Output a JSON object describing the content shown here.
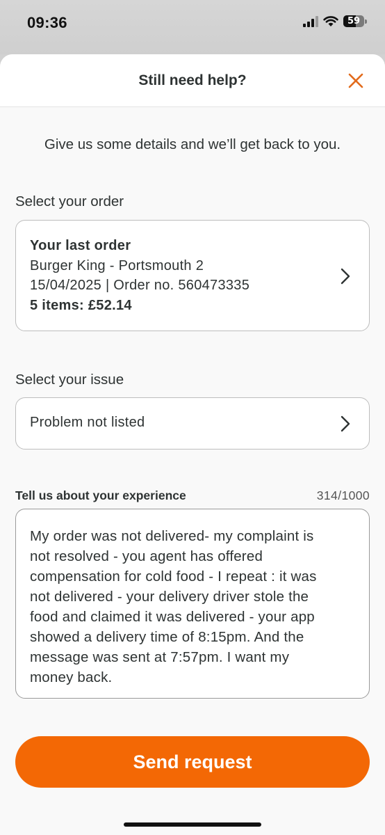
{
  "status_bar": {
    "time": "09:36",
    "battery": "59",
    "battery_level": 0.59
  },
  "header": {
    "title": "Still need help?",
    "close_icon": "close-icon",
    "accent_color": "#e26b1c"
  },
  "intro_text": "Give us some details and we’ll get back to you.",
  "order_section": {
    "label": "Select your order",
    "card": {
      "title": "Your last order",
      "restaurant": "Burger King - Portsmouth 2",
      "date_and_order": "15/04/2025 | Order no. 560473335",
      "summary": "5 items: £52.14",
      "chevron_icon": "chevron-right-icon"
    }
  },
  "issue_section": {
    "label": "Select your issue",
    "value": "Problem not listed",
    "chevron_icon": "chevron-right-icon"
  },
  "experience_section": {
    "label": "Tell us about your experience",
    "counter": "314/1000",
    "text": "My order was not delivered- my complaint is\nnot resolved - you agent has offered\ncompensation for cold food  - I repeat :  it was\nnot delivered - your delivery driver stole the\nfood and claimed it was delivered - your app\nshowed a delivery time of 8:15pm. And the\nmessage was sent at 7:57pm. I want my\nmoney back."
  },
  "send_button": {
    "label": "Send request",
    "color": "#f36805"
  }
}
